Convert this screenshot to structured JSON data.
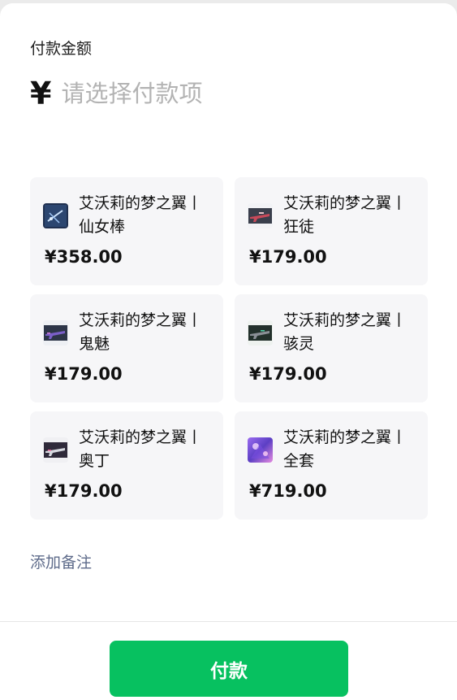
{
  "amount": {
    "label": "付款金额",
    "currency_symbol": "¥",
    "placeholder": "请选择付款项"
  },
  "items": [
    {
      "name": "艾沃莉的梦之翼丨\n仙女棒",
      "price": "¥358.00",
      "icon": "skin-thumbnail-icon"
    },
    {
      "name": "艾沃莉的梦之翼丨\n狂徒",
      "price": "¥179.00",
      "icon": "skin-thumbnail-icon"
    },
    {
      "name": "艾沃莉的梦之翼丨\n鬼魅",
      "price": "¥179.00",
      "icon": "skin-thumbnail-icon"
    },
    {
      "name": "艾沃莉的梦之翼丨\n骇灵",
      "price": "¥179.00",
      "icon": "skin-thumbnail-icon"
    },
    {
      "name": "艾沃莉的梦之翼丨\n奥丁",
      "price": "¥179.00",
      "icon": "skin-thumbnail-icon"
    },
    {
      "name": "艾沃莉的梦之翼丨\n全套",
      "price": "¥719.00",
      "icon": "skin-thumbnail-icon"
    }
  ],
  "remark_label": "添加备注",
  "pay_button_label": "付款",
  "colors": {
    "accent": "#07c160",
    "link": "#5e6b8a",
    "card_bg": "#f6f6f8",
    "placeholder": "#b3b3b3"
  }
}
